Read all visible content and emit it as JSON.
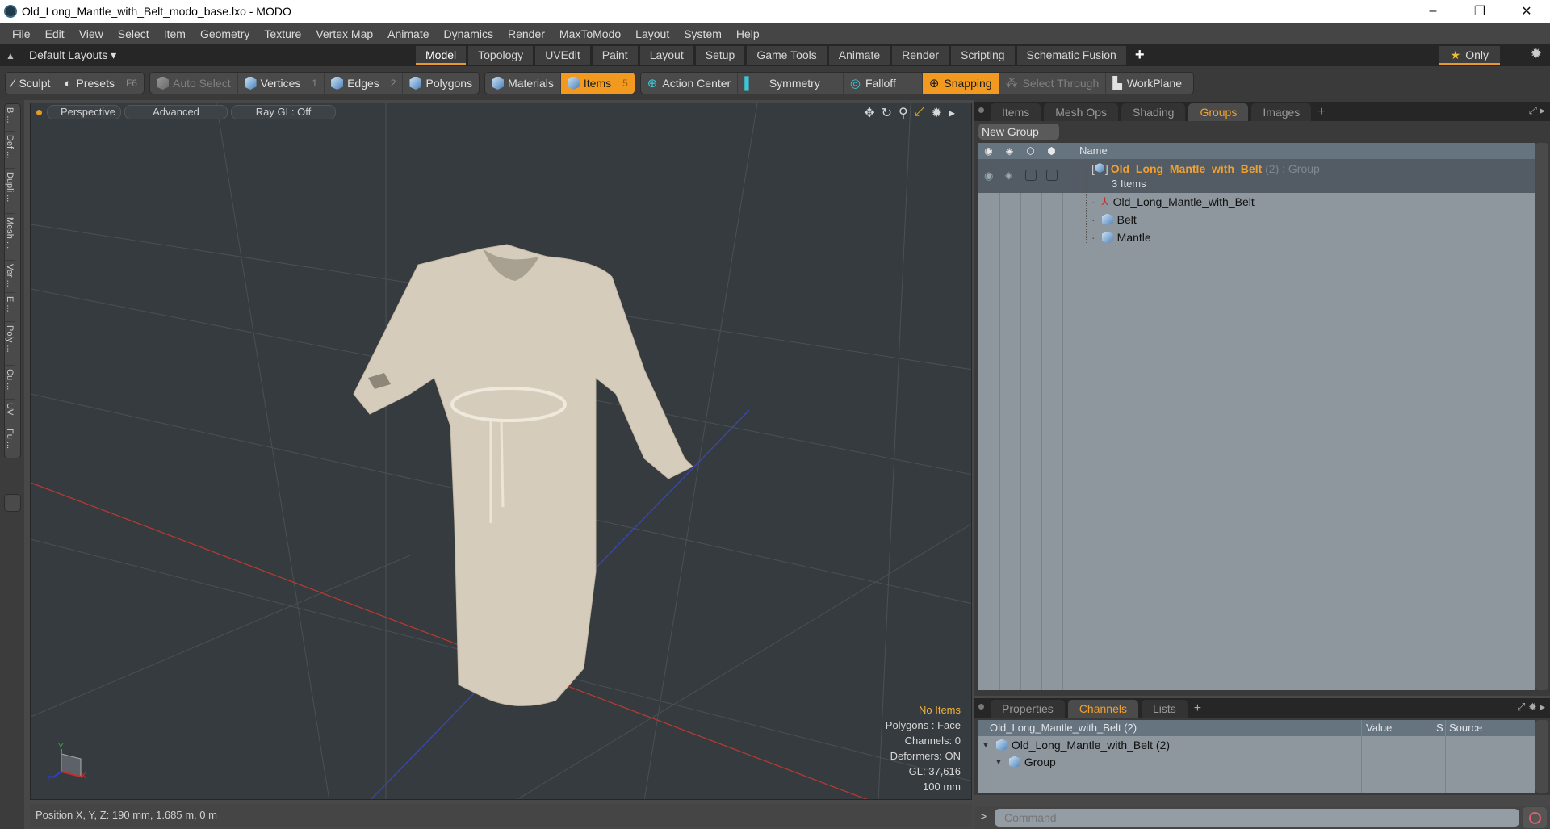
{
  "window": {
    "title": "Old_Long_Mantle_with_Belt_modo_base.lxo - MODO",
    "minimize": "–",
    "maximize": "❐",
    "close": "✕"
  },
  "menubar": [
    "File",
    "Edit",
    "View",
    "Select",
    "Item",
    "Geometry",
    "Texture",
    "Vertex Map",
    "Animate",
    "Dynamics",
    "Render",
    "MaxToModo",
    "Layout",
    "System",
    "Help"
  ],
  "layoutbar": {
    "layouts_dropdown": "Default Layouts ▾",
    "tabs": [
      "Model",
      "Topology",
      "UVEdit",
      "Paint",
      "Layout",
      "Setup",
      "Game Tools",
      "Animate",
      "Render",
      "Scripting",
      "Schematic Fusion"
    ],
    "active_tab": "Model",
    "add": "+",
    "only_label": "Only",
    "star": "★"
  },
  "toolbar": {
    "sculpt": "Sculpt",
    "presets": "Presets",
    "presets_key": "F6",
    "auto_select": "Auto Select",
    "vertices": "Vertices",
    "vertices_key": "1",
    "edges": "Edges",
    "edges_key": "2",
    "polygons": "Polygons",
    "materials": "Materials",
    "items": "Items",
    "items_key": "5",
    "action_center": "Action Center",
    "symmetry": "Symmetry",
    "falloff": "Falloff",
    "snapping": "Snapping",
    "select_through": "Select Through",
    "workplane": "WorkPlane"
  },
  "left_strip": [
    "B ...",
    "Def ...",
    "Dupli ...",
    "Mesh ...",
    "Ver ...",
    "E ...",
    "Poly ...",
    "Cu ...",
    "UV",
    "Fu ..."
  ],
  "viewport": {
    "view_mode": "Perspective",
    "shading": "Advanced",
    "raygl": "Ray GL: Off",
    "info": {
      "selection": "No Items",
      "polygons": "Polygons : Face",
      "channels": "Channels: 0",
      "deformers": "Deformers: ON",
      "gl": "GL: 37,616",
      "grid": "100 mm"
    },
    "axis": {
      "x": "X",
      "y": "Y",
      "z": "Z"
    }
  },
  "statusbar": {
    "position": "Position X, Y, Z:   190 mm, 1.685 m, 0 m"
  },
  "groups_panel": {
    "tabs": [
      "Items",
      "Mesh Ops",
      "Shading",
      "Groups",
      "Images"
    ],
    "active_tab": "Groups",
    "add": "+",
    "new_group": "New Group",
    "column_name": "Name",
    "group": {
      "name": "Old_Long_Mantle_with_Belt",
      "suffix": " (2) : Group",
      "count": "3 Items",
      "items": [
        {
          "name": "Old_Long_Mantle_with_Belt",
          "icon": "locator-icon"
        },
        {
          "name": "Belt",
          "icon": "mesh-icon"
        },
        {
          "name": "Mantle",
          "icon": "mesh-icon"
        }
      ]
    }
  },
  "channels_panel": {
    "tabs": [
      "Properties",
      "Channels",
      "Lists"
    ],
    "active_tab": "Channels",
    "add": "+",
    "columns": {
      "name": "Old_Long_Mantle_with_Belt (2)",
      "value": "Value",
      "s": "S",
      "source": "Source"
    },
    "rows": [
      {
        "name": "Old_Long_Mantle_with_Belt (2)"
      },
      {
        "name": "Group"
      }
    ]
  },
  "command": {
    "prompt": ">",
    "placeholder": "Command"
  },
  "colors": {
    "accent": "#f29a1f",
    "active_tab_text": "#f0a030",
    "viewport_bg": "#363b3f",
    "x_axis": "#c0302a",
    "z_axis": "#3a48b0"
  }
}
